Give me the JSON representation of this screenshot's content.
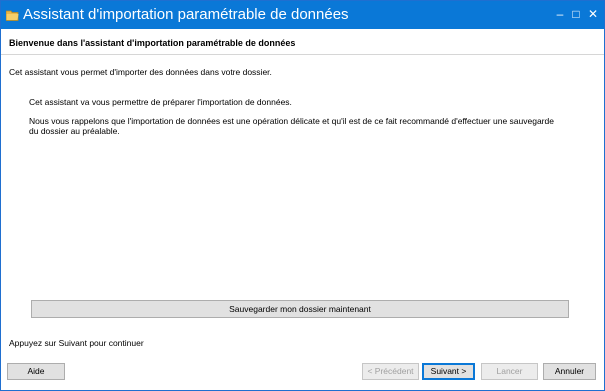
{
  "window": {
    "title": "Assistant d'importation paramétrable de données",
    "controls": {
      "minimize": "–",
      "maximize": "□",
      "close": "✕"
    },
    "icon": "folder-icon"
  },
  "header": {
    "title": "Bienvenue dans l'assistant d'importation paramétrable de données"
  },
  "content": {
    "intro": "Cet assistant vous permet d'importer des données dans votre dossier.",
    "paragraph1": "Cet assistant va vous permettre de préparer l'importation de données.",
    "paragraph2": "Nous vous rappelons que l'importation de données est une opération délicate et qu'il est de ce fait recommandé d'effectuer une sauvegarde du dossier au préalable."
  },
  "backup_button": "Sauvegarder mon dossier maintenant",
  "footer": {
    "hint": "Appuyez sur Suivant pour continuer",
    "help": "Aide",
    "previous": "< Précédent",
    "next": "Suivant >",
    "launch": "Lancer",
    "cancel": "Annuler"
  },
  "colors": {
    "titlebar": "#0a78d7",
    "accent": "#0a78d7"
  }
}
